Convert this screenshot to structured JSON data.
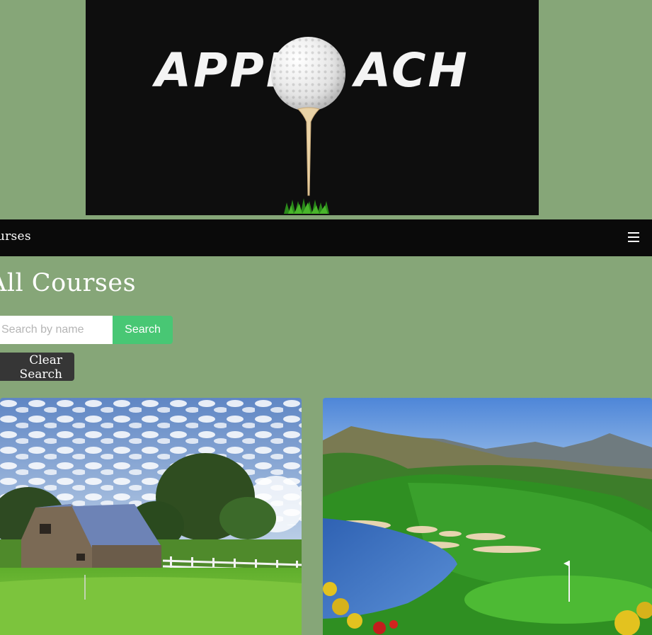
{
  "logo": {
    "text_left": "APPR",
    "text_right": "ACH"
  },
  "navbar": {
    "brand": "Courses",
    "menu_icon": "hamburger-menu-icon"
  },
  "page": {
    "title": "All Courses"
  },
  "search": {
    "placeholder": "Search by name",
    "button_label": "Search",
    "clear_label": "Clear Search"
  },
  "courses": [
    {
      "image": "barn-golf-course-photo"
    },
    {
      "image": "desert-lake-golf-course-photo"
    }
  ],
  "colors": {
    "background": "#86a678",
    "navbar": "#0a0a0a",
    "search_button": "#48c774",
    "clear_button": "#363636"
  }
}
